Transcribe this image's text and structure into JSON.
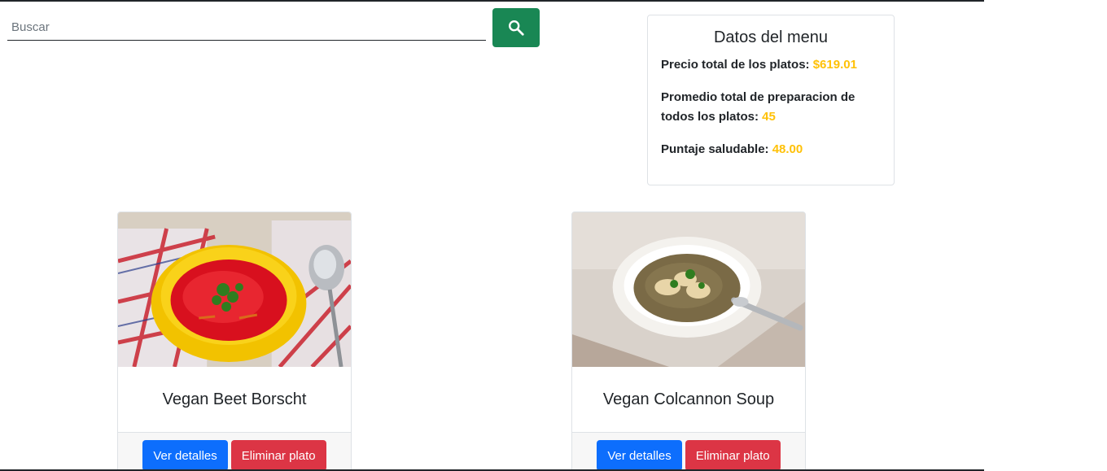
{
  "search": {
    "placeholder": "Buscar",
    "value": "",
    "icon": "search-icon",
    "button_color": "#198754"
  },
  "menu_info": {
    "title": "Datos del menu",
    "total_price_label": "Precio total de los platos: ",
    "total_price_value": "$619.01",
    "avg_prep_label": "Promedio total de preparacion de todos los platos: ",
    "avg_prep_value": "45",
    "health_score_label": "Puntaje saludable: ",
    "health_score_value": "48.00",
    "value_color": "#ffc107"
  },
  "dishes": [
    {
      "name": "Vegan Beet Borscht",
      "details_label": "Ver detalles",
      "delete_label": "Eliminar plato"
    },
    {
      "name": "Vegan Colcannon Soup",
      "details_label": "Ver detalles",
      "delete_label": "Eliminar plato"
    }
  ],
  "colors": {
    "primary": "#0d6efd",
    "danger": "#dc3545",
    "success": "#198754",
    "warning": "#ffc107"
  }
}
